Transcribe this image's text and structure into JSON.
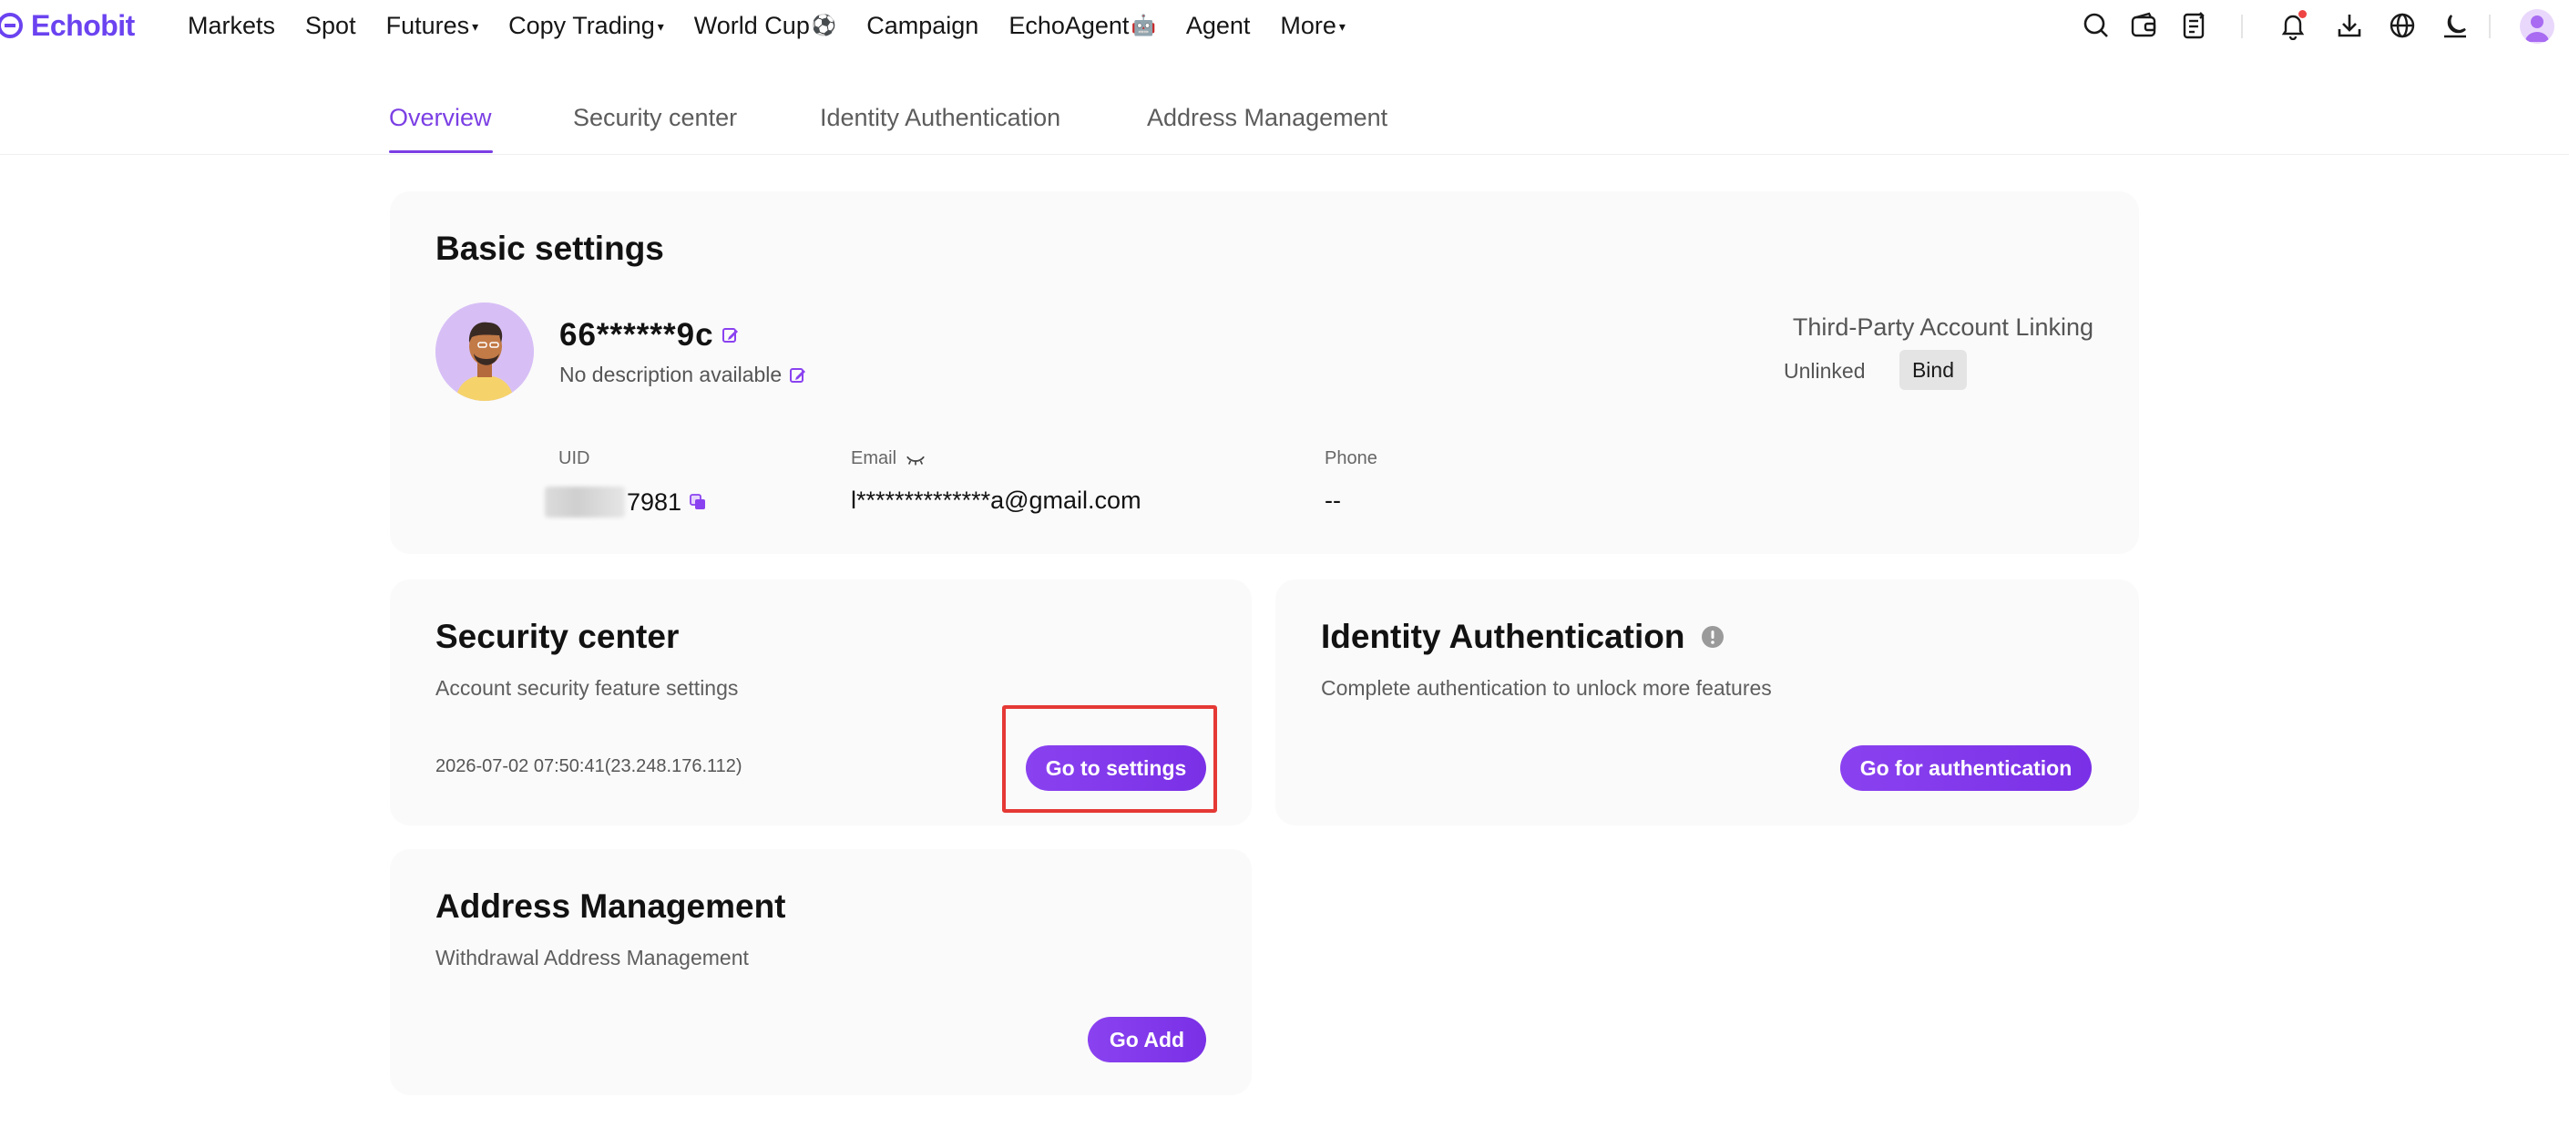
{
  "app": {
    "brand": "Echobit",
    "accent_color": "#7b3fe4",
    "brand_color": "#6b43f0"
  },
  "nav": {
    "items": [
      {
        "label": "Markets"
      },
      {
        "label": "Spot"
      },
      {
        "label": "Futures",
        "caret": "▾"
      },
      {
        "label": "Copy Trading",
        "caret": "▾"
      },
      {
        "label": "World Cup",
        "emoji": "⚽"
      },
      {
        "label": "Campaign"
      },
      {
        "label": "EchoAgent",
        "emoji": "🤖"
      },
      {
        "label": "Agent"
      },
      {
        "label": "More",
        "caret": "▾"
      }
    ],
    "icons": [
      "search-icon",
      "wallet-icon",
      "orders-icon",
      "bell-icon",
      "download-icon",
      "globe-icon",
      "moon-icon",
      "avatar"
    ]
  },
  "tabs": [
    {
      "label": "Overview",
      "active": true
    },
    {
      "label": "Security center"
    },
    {
      "label": "Identity Authentication"
    },
    {
      "label": "Address Management"
    }
  ],
  "basic": {
    "title": "Basic settings",
    "username": "66******9c",
    "description": "No description available",
    "uid_label": "UID",
    "uid_value": "7981",
    "email_label": "Email",
    "email_value": "l**************a@gmail.com",
    "phone_label": "Phone",
    "phone_value": "--",
    "third_party_title": "Third-Party Account Linking",
    "third_party_status": "Unlinked",
    "bind_label": "Bind"
  },
  "security": {
    "title": "Security center",
    "subtitle": "Account security feature settings",
    "timestamp": "2026-07-02 07:50:41(23.248.176.112)",
    "button": "Go to settings"
  },
  "identity": {
    "title": "Identity Authentication",
    "subtitle": "Complete authentication to unlock more features",
    "button": "Go for authentication"
  },
  "address": {
    "title": "Address Management",
    "subtitle": "Withdrawal Address Management",
    "button": "Go Add"
  }
}
